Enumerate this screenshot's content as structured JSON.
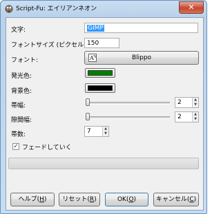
{
  "window": {
    "title": "Script-Fu: エイリアンネオン",
    "close_label": "✕"
  },
  "form": {
    "text_label": "文字:",
    "text_value": "GIMP",
    "font_size_label": "フォントサイズ (ピクセル):",
    "font_size_value": "150",
    "font_label": "フォント:",
    "font_value": "Blippo",
    "glow_color_label": "発光色:",
    "glow_color": "#008000",
    "bg_color_label": "背景色:",
    "bg_color": "#000000",
    "band_width_label": "帯幅:",
    "band_width_value": "2",
    "gap_width_label": "隙間幅:",
    "gap_width_value": "2",
    "band_count_label": "帯数:",
    "band_count_value": "7",
    "fade_label": "フェードしていく",
    "fade_checked": true
  },
  "buttons": {
    "help_label": "ヘルプ(",
    "help_key": "H",
    "reset_label": "リセット(",
    "reset_key": "R",
    "ok_label": "OK(",
    "ok_key": "O",
    "cancel_label": "キャンセル(",
    "cancel_key": "C",
    "close_paren": ")"
  },
  "icons": {
    "window": "gimp-app-icon",
    "font_picker": "font-icon",
    "spin_up": "▲",
    "spin_down": "▼",
    "check": "✓"
  },
  "colors": {
    "selection": "#3399ff",
    "titlebar": "#b9d1ea"
  }
}
